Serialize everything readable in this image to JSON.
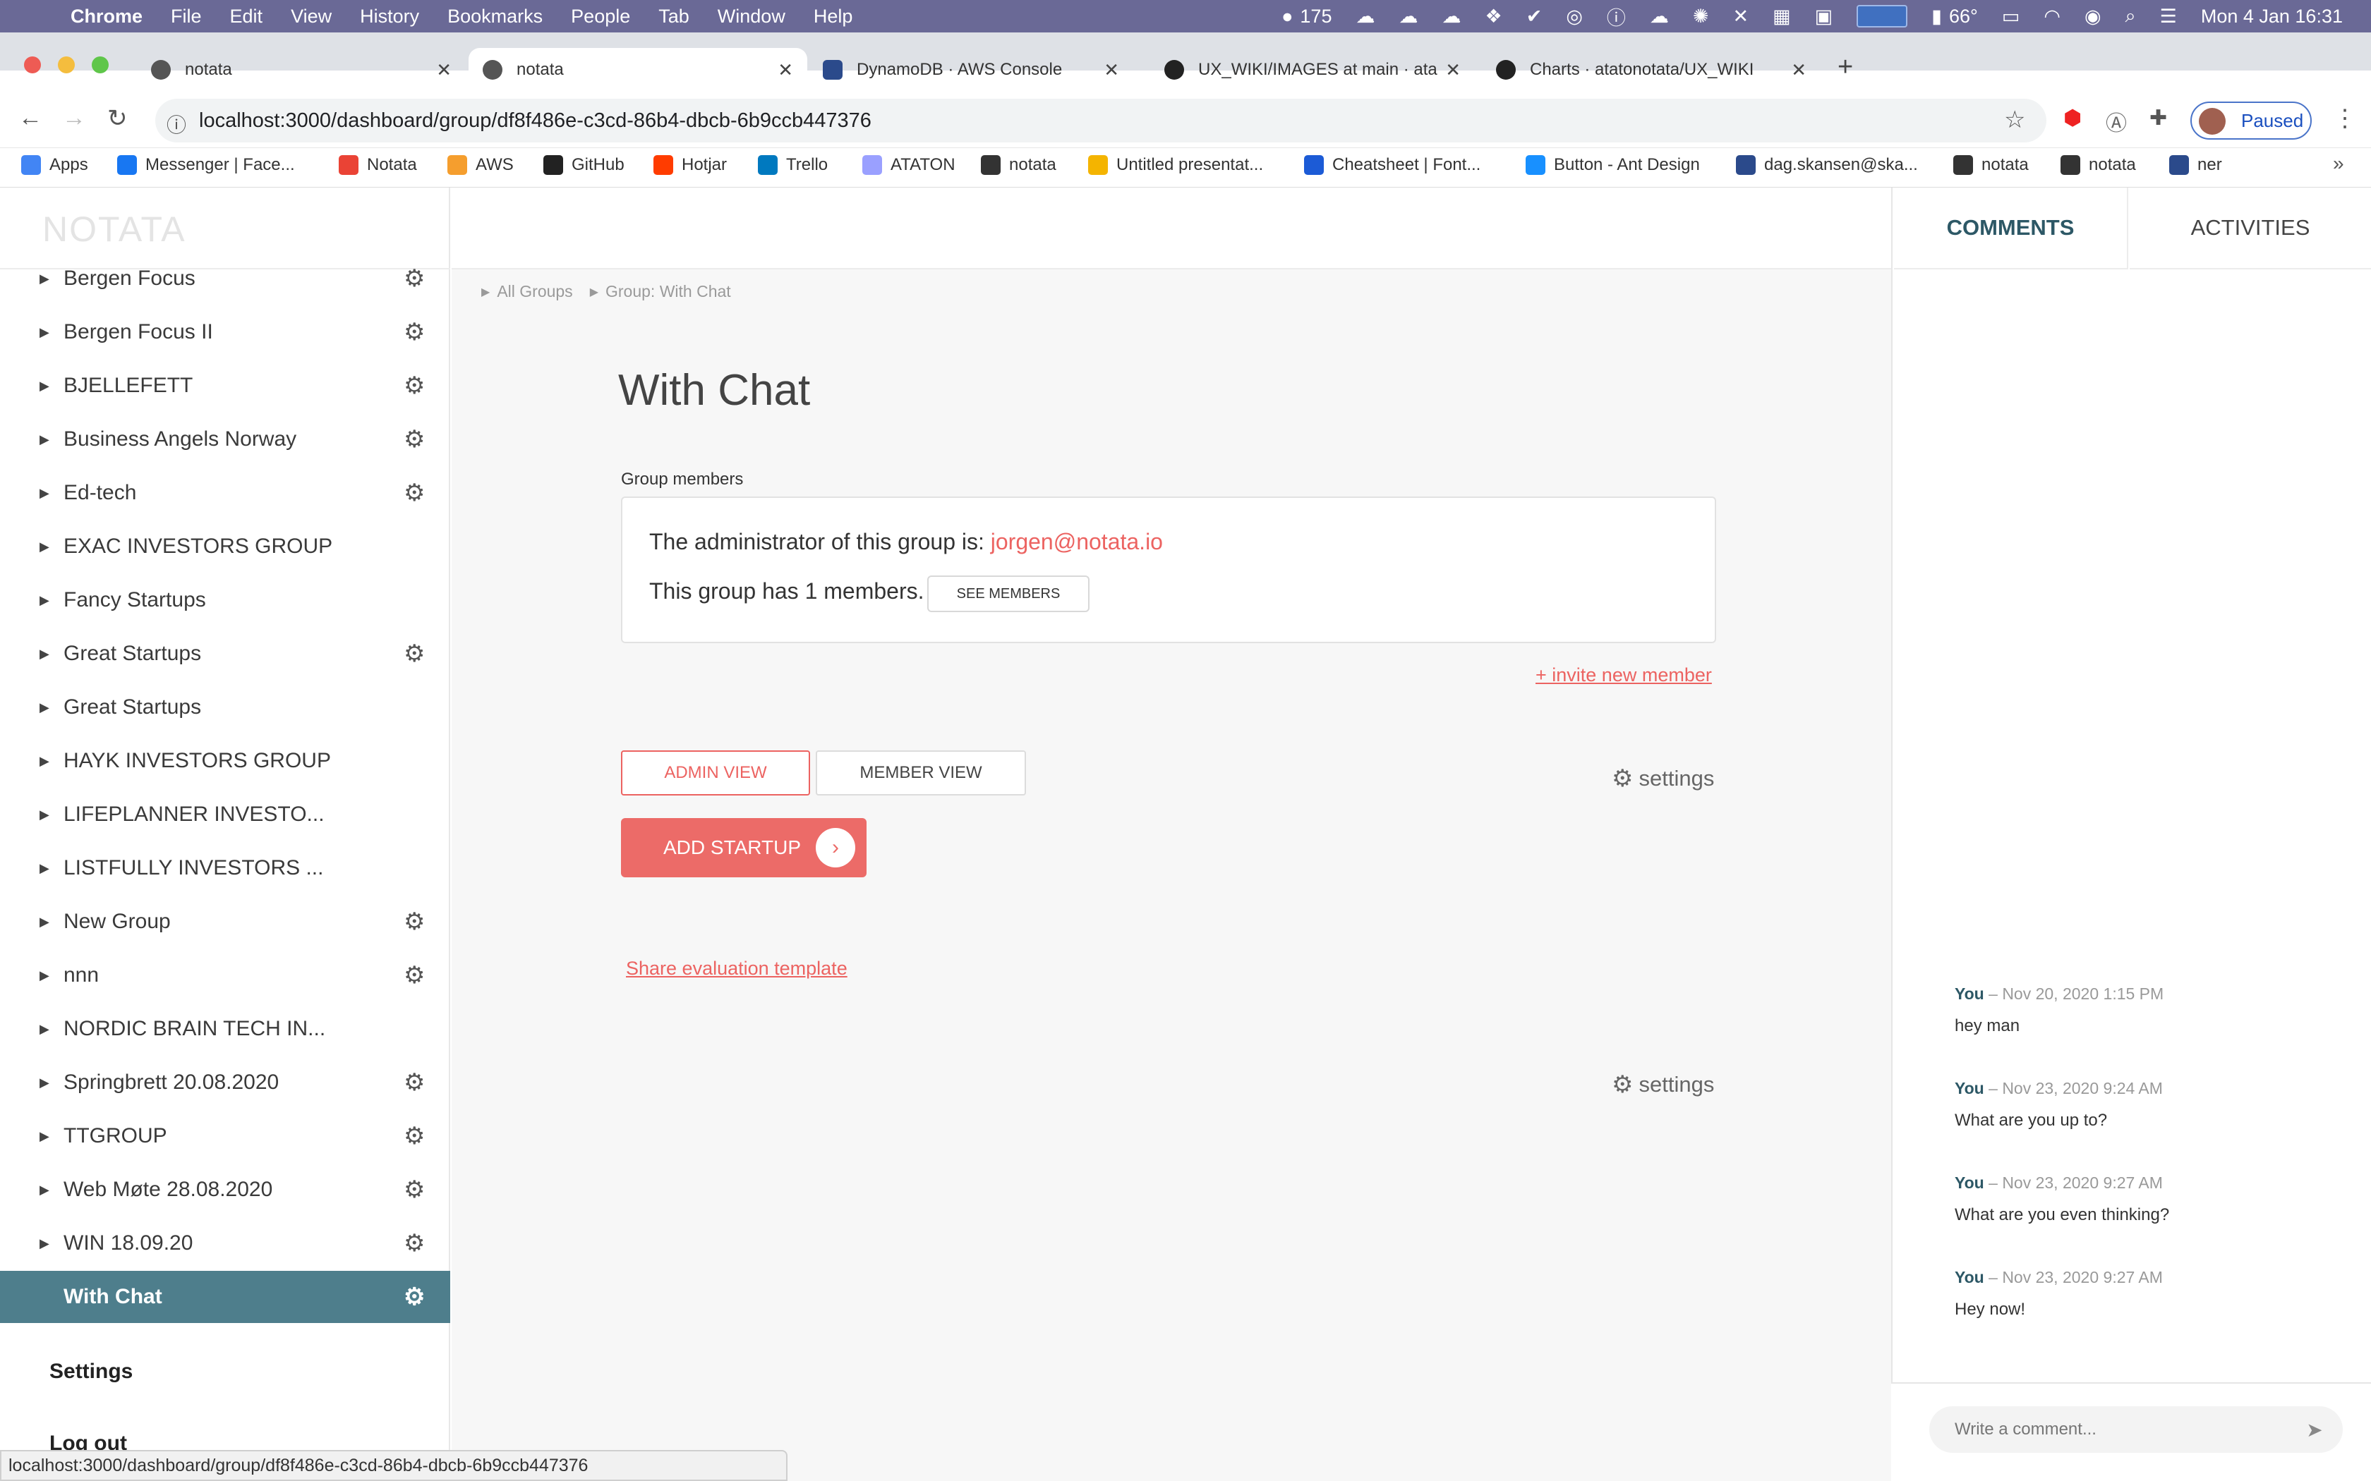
{
  "menubar": {
    "app": "Chrome",
    "items": [
      "File",
      "Edit",
      "View",
      "History",
      "Bookmarks",
      "People",
      "Tab",
      "Window",
      "Help"
    ],
    "status": {
      "badge_count": "175",
      "temperature": "66°",
      "datetime": "Mon 4 Jan  16:31"
    }
  },
  "tabs": [
    {
      "title": "notata",
      "active": false
    },
    {
      "title": "notata",
      "active": true
    },
    {
      "title": "DynamoDB · AWS Console",
      "active": false
    },
    {
      "title": "UX_WIKI/IMAGES at main · ata",
      "active": false
    },
    {
      "title": "Charts · atatonotata/UX_WIKI",
      "active": false
    }
  ],
  "toolbar": {
    "url": "localhost:3000/dashboard/group/df8f486e-c3cd-86b4-dbcb-6b9ccb447376",
    "profile_status": "Paused"
  },
  "bookmarks": [
    {
      "label": "Apps",
      "color": "#4285f4"
    },
    {
      "label": "Messenger | Face...",
      "color": "#1877f2"
    },
    {
      "label": "Notata",
      "color": "#ea4335"
    },
    {
      "label": "AWS",
      "color": "#f59e2e"
    },
    {
      "label": "GitHub",
      "color": "#222222"
    },
    {
      "label": "Hotjar",
      "color": "#ff3c00"
    },
    {
      "label": "Trello",
      "color": "#0079bf"
    },
    {
      "label": "ATATON",
      "color": "#9aa0ff"
    },
    {
      "label": "notata",
      "color": "#333333"
    },
    {
      "label": "Untitled presentat...",
      "color": "#f4b400"
    },
    {
      "label": "Cheatsheet | Font...",
      "color": "#1c5bd6"
    },
    {
      "label": "Button - Ant Design",
      "color": "#1890ff"
    },
    {
      "label": "dag.skansen@ska...",
      "color": "#2b4a8b"
    },
    {
      "label": "notata",
      "color": "#333333"
    },
    {
      "label": "notata",
      "color": "#333333"
    },
    {
      "label": "ner",
      "color": "#2b4a8b"
    }
  ],
  "sidebar": {
    "logo": "NOTATA",
    "groups": [
      {
        "label": "Bergen Focus",
        "gear": true
      },
      {
        "label": "Bergen Focus II",
        "gear": true
      },
      {
        "label": "BJELLEFETT",
        "gear": true
      },
      {
        "label": "Business Angels Norway",
        "gear": true
      },
      {
        "label": "Ed-tech",
        "gear": true
      },
      {
        "label": "EXAC INVESTORS GROUP",
        "gear": false
      },
      {
        "label": "Fancy Startups",
        "gear": false
      },
      {
        "label": "Great Startups",
        "gear": true
      },
      {
        "label": "Great Startups",
        "gear": false
      },
      {
        "label": "HAYK INVESTORS GROUP",
        "gear": false
      },
      {
        "label": "LIFEPLANNER INVESTO...",
        "gear": false
      },
      {
        "label": "LISTFULLY INVESTORS ...",
        "gear": false
      },
      {
        "label": "New Group",
        "gear": true
      },
      {
        "label": "nnn",
        "gear": true
      },
      {
        "label": "NORDIC BRAIN TECH IN...",
        "gear": false
      },
      {
        "label": "Springbrett 20.08.2020",
        "gear": true
      },
      {
        "label": "TTGROUP",
        "gear": true
      },
      {
        "label": "Web Møte 28.08.2020",
        "gear": true
      },
      {
        "label": "WIN 18.09.20",
        "gear": true
      },
      {
        "label": "With Chat",
        "gear": true,
        "active": true
      }
    ],
    "settings": "Settings",
    "logout": "Log out"
  },
  "main": {
    "breadcrumb": [
      "All Groups",
      "Group: With Chat"
    ],
    "title": "With Chat",
    "members_label": "Group members",
    "admin_prefix": "The administrator of this group is: ",
    "admin_email": "jorgen@notata.io",
    "member_count_text": "This group has 1 members.",
    "see_members": "SEE MEMBERS",
    "invite": "+ invite new member",
    "admin_view": "ADMIN VIEW",
    "member_view": "MEMBER VIEW",
    "settings_label": "settings",
    "add_startup": "ADD STARTUP",
    "share_template": "Share evaluation template",
    "settings_label_2": "settings"
  },
  "panel": {
    "tabs": [
      "COMMENTS",
      "ACTIVITIES"
    ],
    "comments": [
      {
        "author": "You",
        "time": "Nov 20, 2020 1:15 PM",
        "text": "hey man"
      },
      {
        "author": "You",
        "time": "Nov 23, 2020 9:24 AM",
        "text": "What are you up to?"
      },
      {
        "author": "You",
        "time": "Nov 23, 2020 9:27 AM",
        "text": "What are you even thinking?"
      },
      {
        "author": "You",
        "time": "Nov 23, 2020 9:27 AM",
        "text": "Hey now!"
      }
    ],
    "input_placeholder": "Write a comment..."
  },
  "statusbar": {
    "url": "localhost:3000/dashboard/group/df8f486e-c3cd-86b4-dbcb-6b9ccb447376"
  },
  "colors": {
    "accent": "#ec6361",
    "teal": "#4e7e8c",
    "menubar": "#6a6996"
  }
}
